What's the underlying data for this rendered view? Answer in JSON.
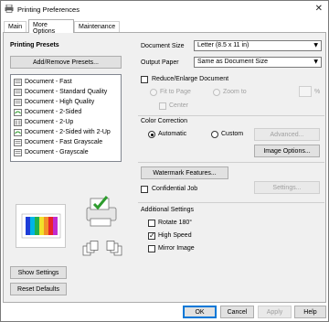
{
  "window": {
    "title": "Printing Preferences",
    "close_glyph": "✕"
  },
  "tabs": [
    {
      "label": "Main"
    },
    {
      "label": "More Options"
    },
    {
      "label": "Maintenance"
    }
  ],
  "presets": {
    "heading": "Printing Presets",
    "add_remove_label": "Add/Remove Presets...",
    "items": [
      {
        "label": "Document - Fast",
        "icon": "document-icon"
      },
      {
        "label": "Document - Standard Quality",
        "icon": "document-icon"
      },
      {
        "label": "Document - High Quality",
        "icon": "document-icon"
      },
      {
        "label": "Document - 2-Sided",
        "icon": "two-sided-icon"
      },
      {
        "label": "Document - 2-Up",
        "icon": "two-up-icon"
      },
      {
        "label": "Document - 2-Sided with 2-Up",
        "icon": "two-sided-icon"
      },
      {
        "label": "Document - Fast Grayscale",
        "icon": "document-icon"
      },
      {
        "label": "Document - Grayscale",
        "icon": "document-icon"
      }
    ]
  },
  "show_settings_label": "Show Settings",
  "reset_defaults_label": "Reset Defaults",
  "document_size": {
    "label": "Document Size",
    "value": "Letter (8.5 x 11 in)"
  },
  "output_paper": {
    "label": "Output Paper",
    "value": "Same as Document Size"
  },
  "reduce_enlarge": {
    "label": "Reduce/Enlarge Document",
    "checked": false,
    "fit_to_page_label": "Fit to Page",
    "zoom_to_label": "Zoom to",
    "center_label": "Center",
    "percent": "%"
  },
  "color_correction": {
    "heading": "Color Correction",
    "automatic_label": "Automatic",
    "custom_label": "Custom",
    "advanced_label": "Advanced...",
    "image_options_label": "Image Options..."
  },
  "watermark_label": "Watermark Features...",
  "confidential_job": {
    "label": "Confidential Job",
    "settings_label": "Settings..."
  },
  "additional": {
    "heading": "Additional Settings",
    "rotate_label": "Rotate 180°",
    "high_speed_label": "High Speed",
    "mirror_label": "Mirror Image"
  },
  "footer": {
    "ok": "OK",
    "cancel": "Cancel",
    "apply": "Apply",
    "help": "Help"
  }
}
